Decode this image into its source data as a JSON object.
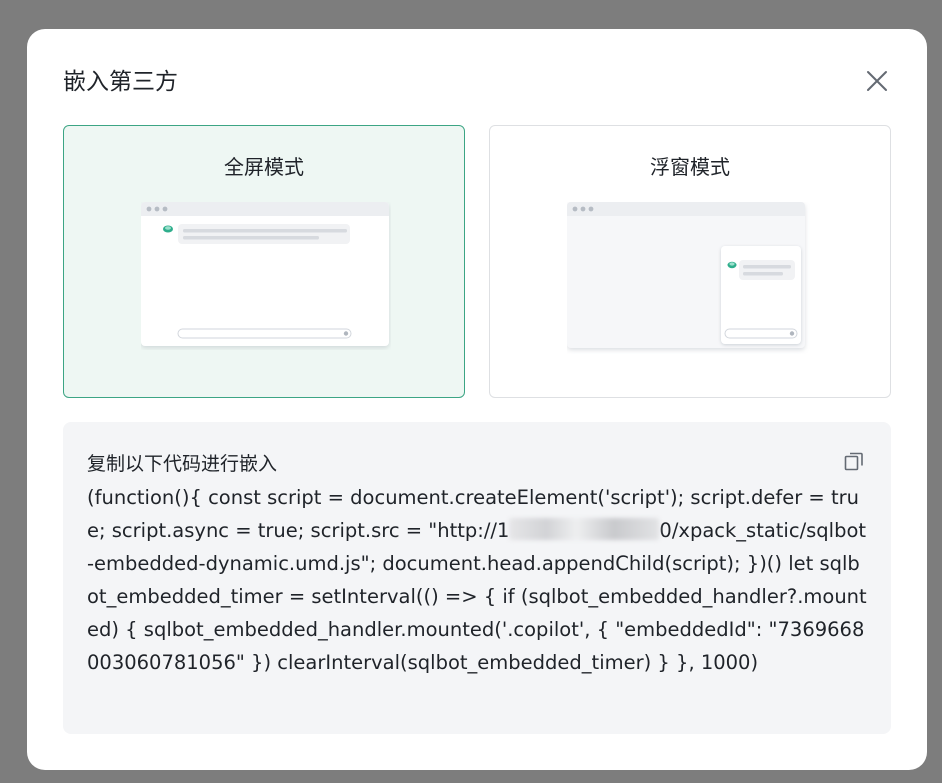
{
  "dialog": {
    "title": "嵌入第三方"
  },
  "modes": {
    "fullscreen": {
      "label": "全屏模式",
      "selected": true
    },
    "floating": {
      "label": "浮窗模式",
      "selected": false
    }
  },
  "code": {
    "heading": "复制以下代码进行嵌入",
    "line_before_blur": "(function(){ const script = document.createElement('script'); script.defer = true; script.async = true; script.src = \"http://1",
    "line_after_blur": "0/xpack_static/sqlbot-embedded-dynamic.umd.js\"; document.head.appendChild(script); })() let sqlbot_embedded_timer = setInterval(() => { if (sqlbot_embedded_handler?.mounted) { sqlbot_embedded_handler.mounted('.copilot', { \"embeddedId\": \"7369668003060781056\" }) clearInterval(sqlbot_embedded_timer) } }, 1000)"
  },
  "colors": {
    "accent": "#3ca584",
    "selected_bg": "#eef7f3",
    "overlay": "#7d7d7d",
    "code_bg": "#f4f5f7"
  },
  "icons": {
    "close": "close-icon",
    "copy": "copy-icon"
  }
}
